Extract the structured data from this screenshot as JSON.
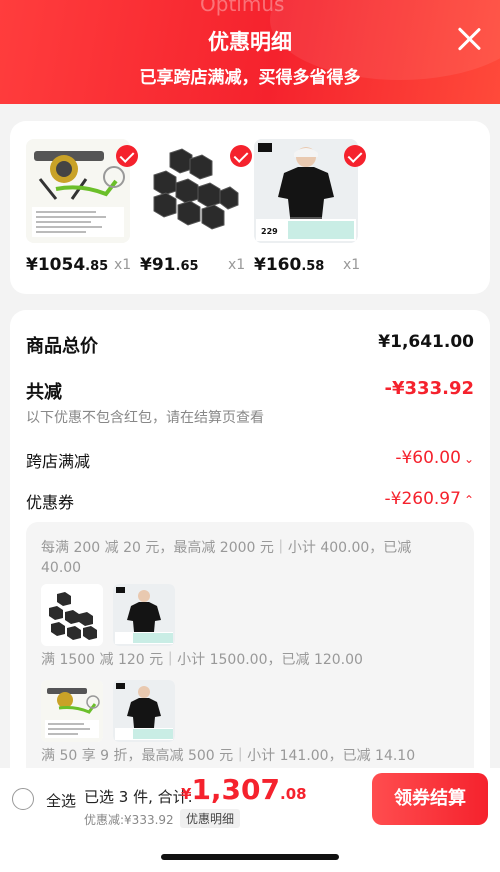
{
  "header": {
    "background_text": "Optimus",
    "title": "优惠明细",
    "subtitle": "已享跨店满减，买得多省得多",
    "close_icon": "close-icon"
  },
  "products": [
    {
      "name": "stove",
      "price_int": "¥1054",
      "price_dec": ".85",
      "qty": "x1",
      "checked": true
    },
    {
      "name": "charcoal",
      "price_int": "¥91",
      "price_dec": ".65",
      "qty": "x1",
      "checked": true
    },
    {
      "name": "tshirt",
      "price_int": "¥160",
      "price_dec": ".58",
      "qty": "x1",
      "checked": true
    }
  ],
  "tshirt_tag": {
    "price": "229"
  },
  "summary": {
    "total_label": "商品总价",
    "total_value": "¥1,641.00",
    "reduce_label": "共减",
    "reduce_value": "-¥333.92",
    "note": "以下优惠不包含红包，请在结算页查看",
    "cross_store_label": "跨店满减",
    "cross_store_value": "-¥60.00",
    "coupon_label": "优惠券",
    "coupon_value": "-¥260.97"
  },
  "coupon_rules": [
    "每满 200 减 20 元，最高减 2000 元｜小计 400.00，已减 40.00",
    "满 1500 减 120 元｜小计 1500.00，已减 120.00",
    "满 50 享 9 折，最高减 500 元｜小计 141.00，已减 14.10"
  ],
  "bottom": {
    "select_all": "全选",
    "selected_info": "已选 3 件, 合计:",
    "total_currency": "¥",
    "total_int": "1,307",
    "total_dec": ".08",
    "discount_line": "优惠减:¥333.92",
    "detail_tag": "优惠明细",
    "checkout": "领券结算"
  },
  "colors": {
    "accent": "#f5222d",
    "background": "#f3f3f3"
  }
}
